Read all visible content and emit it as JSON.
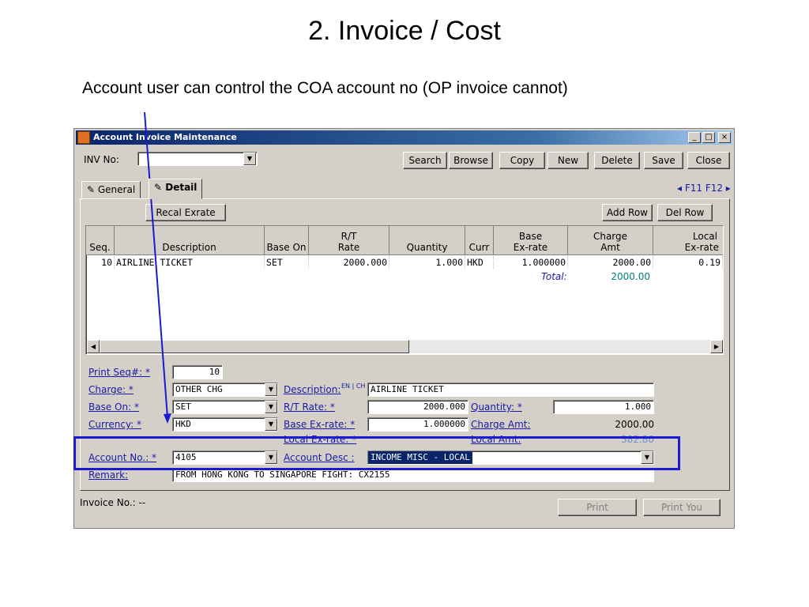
{
  "slide": {
    "title": "2. Invoice / Cost",
    "subtitle": "Account user can control the COA account no (OP invoice cannot)"
  },
  "window": {
    "title": "Account Invoice Maintenance",
    "min_label": "_",
    "max_label": "□",
    "close_label": "×"
  },
  "toolbar": {
    "inv_no_label": "INV No:",
    "inv_no_value": "",
    "search": "Search",
    "browse": "Browse",
    "copy": "Copy",
    "new": "New",
    "delete": "Delete",
    "save": "Save",
    "close": "Close"
  },
  "tabs": {
    "general": "General",
    "detail": "Detail",
    "fkeys": "◂ F11 F12 ▸"
  },
  "detail": {
    "recal_button": "Recal Exrate",
    "add_row": "Add Row",
    "del_row": "Del Row",
    "grid": {
      "headers": {
        "seq": "Seq.",
        "description": "Description",
        "base_on": "Base On",
        "rt_rate_1": "R/T",
        "rt_rate_2": "Rate",
        "quantity": "Quantity",
        "curr": "Curr",
        "base_exrate_1": "Base",
        "base_exrate_2": "Ex-rate",
        "charge_amt_1": "Charge",
        "charge_amt_2": "Amt",
        "local_exrate_1": "Local",
        "local_exrate_2": "Ex-rate"
      },
      "row": {
        "seq": "10",
        "description": "AIRLINE TICKET",
        "base_on": "SET",
        "rt_rate": "2000.000",
        "quantity": "1.000",
        "curr": "HKD",
        "base_exrate": "1.000000",
        "charge_amt": "2000.00",
        "local_exrate": "0.19"
      },
      "total_label": "Total:",
      "total_value": "2000.00"
    },
    "form": {
      "print_seq_label": "Print Seq#: *",
      "print_seq_value": "10",
      "charge_label": "Charge: *",
      "charge_value": "OTHER CHG",
      "description_label": "Description:",
      "lang_tag": "EN | CH",
      "description_value": "AIRLINE TICKET",
      "base_on_label": "Base On: *",
      "base_on_value": "SET",
      "rt_rate_label": "R/T Rate: *",
      "rt_rate_value": "2000.000",
      "quantity_label": "Quantity: *",
      "quantity_value": "1.000",
      "currency_label": "Currency: *",
      "currency_value": "HKD",
      "base_exrate_label": "Base Ex-rate: *",
      "base_exrate_value": "1.000000",
      "charge_amt_label": "Charge Amt:",
      "charge_amt_value": "2000.00",
      "local_exrate_label": "Local Ex-rate: *",
      "local_amt_label": "Local Amt:",
      "local_amt_value": "382.80",
      "account_no_label": "Account No.: *",
      "account_no_value": "4105",
      "account_desc_label": "Account Desc :",
      "account_desc_value": "INCOME MISC - LOCAL",
      "remark_label": "Remark:",
      "remark_value": "FROM HONG KONG TO SINGAPORE  FIGHT: CX2155"
    }
  },
  "footer": {
    "invoice_no_label": "Invoice No.: --",
    "print": "Print",
    "print_you": "Print You"
  },
  "colors": {
    "annotation": "#1a1ad0",
    "window_face": "#d4d0c8",
    "required_label": "#1a1aa8"
  }
}
